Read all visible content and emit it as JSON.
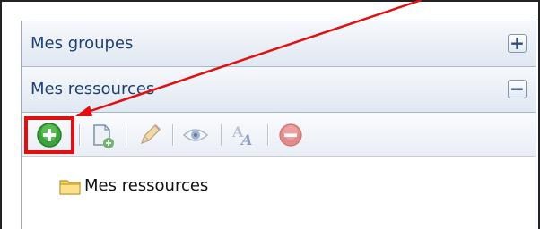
{
  "panel": {
    "sections": [
      {
        "title": "Mes groupes",
        "toggle": "+"
      },
      {
        "title": "Mes ressources",
        "toggle": "−"
      }
    ]
  },
  "toolbar": {
    "buttons": [
      {
        "icon": "add-circle-icon",
        "state": "enabled",
        "highlighted": true
      },
      {
        "icon": "new-document-icon",
        "state": "disabled"
      },
      {
        "icon": "pencil-icon",
        "state": "disabled"
      },
      {
        "icon": "eye-icon",
        "state": "disabled"
      },
      {
        "icon": "text-style-icon",
        "state": "disabled"
      },
      {
        "icon": "remove-circle-icon",
        "state": "disabled"
      }
    ]
  },
  "tree": {
    "items": [
      {
        "icon": "folder-icon",
        "label": "Mes ressources"
      }
    ]
  },
  "colors": {
    "header_text": "#1f3f74",
    "highlight_box": "#e01010",
    "arrow": "#e01010",
    "add_button": "#3aa33a",
    "remove_button": "#e58a8a"
  }
}
